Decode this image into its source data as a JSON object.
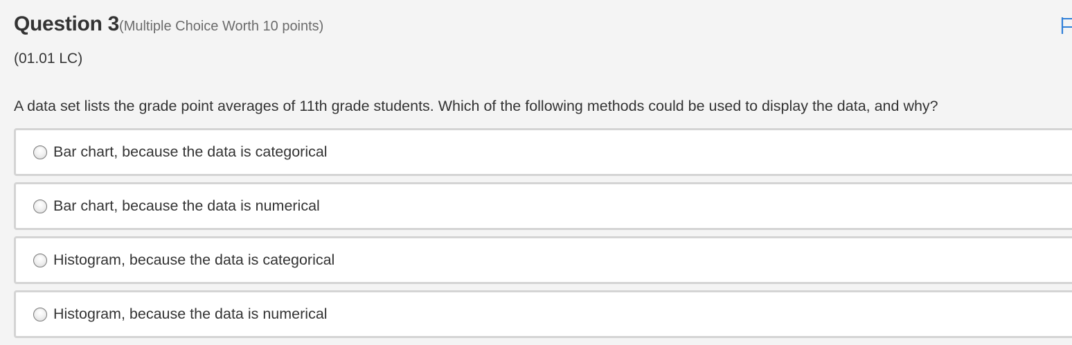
{
  "question": {
    "title": "Question 3",
    "meta": "(Multiple Choice Worth 10 points)",
    "lesson_code": "(01.01 LC)",
    "prompt": "A data set lists the grade point averages of 11th grade students. Which of the following methods could be used to display the data, and why?"
  },
  "choices": [
    {
      "label": "Bar chart, because the data is categorical"
    },
    {
      "label": "Bar chart, because the data is numerical"
    },
    {
      "label": "Histogram, because the data is categorical"
    },
    {
      "label": "Histogram, because the data is numerical"
    }
  ],
  "flag": {
    "icon": "flag-icon"
  },
  "colors": {
    "background": "#f4f4f4",
    "choice_background": "#ffffff",
    "choice_border": "#d4d4d4",
    "text": "#333333",
    "meta_text": "#6b6b6b",
    "flag_accent": "#2f7fd8"
  }
}
